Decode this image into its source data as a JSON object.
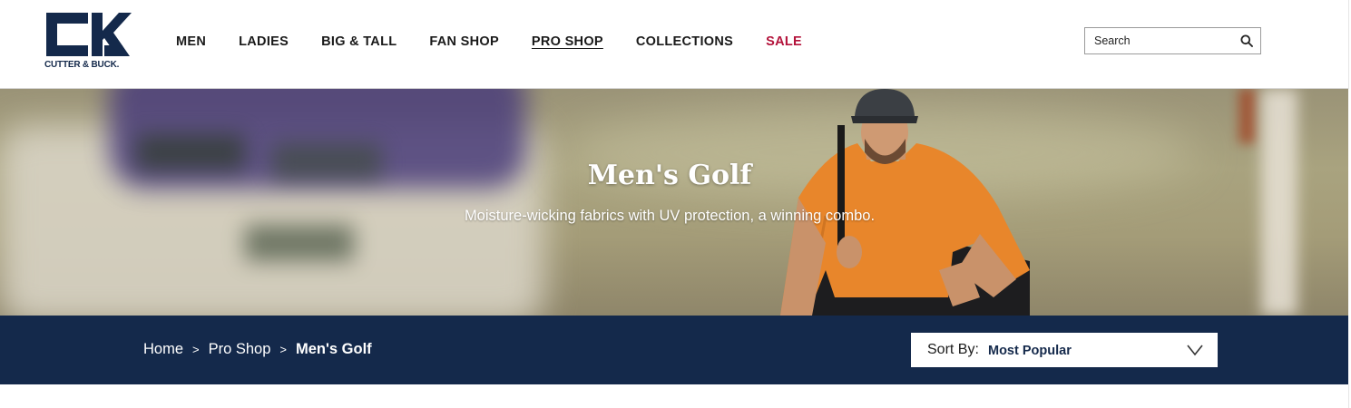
{
  "brand": {
    "name": "CUTTER & BUCK.",
    "primary": "#14294b",
    "sale_color": "#b3123a"
  },
  "nav": {
    "items": [
      {
        "label": "MEN"
      },
      {
        "label": "LADIES"
      },
      {
        "label": "BIG & TALL"
      },
      {
        "label": "FAN SHOP"
      },
      {
        "label": "PRO SHOP"
      },
      {
        "label": "COLLECTIONS"
      },
      {
        "label": "SALE"
      }
    ],
    "active": "PRO SHOP"
  },
  "search": {
    "placeholder": "Search",
    "icon": "search-icon"
  },
  "hero": {
    "title": "Men's Golf",
    "subtitle": "Moisture-wicking fabrics with UV protection, a winning combo."
  },
  "breadcrumb": {
    "items": [
      {
        "label": "Home"
      },
      {
        "label": "Pro Shop"
      },
      {
        "label": "Men's Golf"
      }
    ],
    "separator": ">"
  },
  "sort": {
    "label": "Sort By:",
    "value": "Most Popular",
    "icon": "chevron-down-icon"
  }
}
